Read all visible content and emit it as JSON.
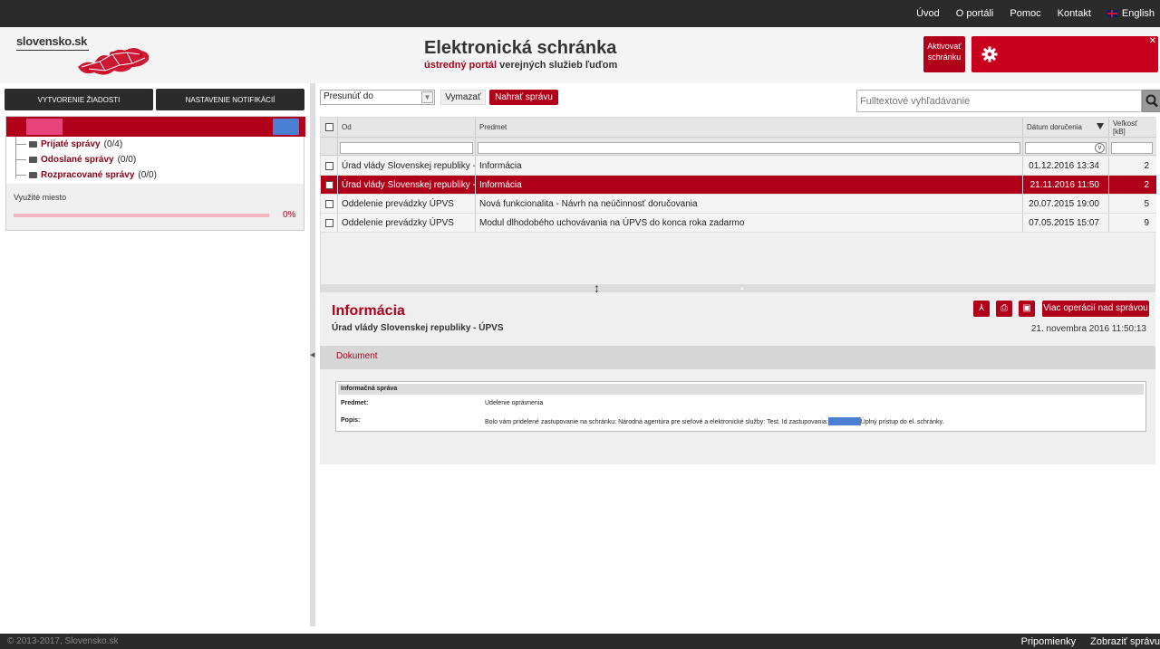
{
  "topnav": {
    "items": [
      "Úvod",
      "O portáli",
      "Pomoc",
      "Kontakt"
    ],
    "language": "English"
  },
  "header": {
    "logo_text": "slovensko.sk",
    "title": "Elektronická schránka",
    "subtitle_red": "ústredný portál",
    "subtitle_rest": "verejných služieb ľuďom",
    "activate_line1": "Aktivovať",
    "activate_line2": "schránku"
  },
  "sidebar": {
    "btn_create": "Vytvorenie žiadosti",
    "btn_notify": "Nastavenie notifikácií",
    "folders": [
      {
        "name": "Prijaté správy",
        "count": "(0/4)"
      },
      {
        "name": "Odoslané správy",
        "count": "(0/0)"
      },
      {
        "name": "Rozpracované správy",
        "count": "(0/0)"
      }
    ],
    "usage_label": "Využité miesto",
    "usage_pct": "0%",
    "usage_fraction": 0
  },
  "toolbar": {
    "move_select": "Presunúť do",
    "delete": "Vymazať",
    "upload": "Nahrať správu",
    "search_placeholder": "Fulltextové vyhľadávanie"
  },
  "grid": {
    "columns": {
      "from": "Od",
      "subject": "Predmet",
      "date": "Dátum doručenia",
      "size": "Veľkosť [kB]"
    },
    "rows": [
      {
        "from": "Úrad vlády Slovenskej republiky - ÚPVS",
        "subject": "Informácia",
        "date": "01.12.2016 13:34",
        "size": "2",
        "selected": false
      },
      {
        "from": "Úrad vlády Slovenskej republiky - ÚPVS",
        "subject": "Informácia",
        "date": "21.11.2016 11:50",
        "size": "2",
        "selected": true
      },
      {
        "from": "Oddelenie prevádzky ÚPVS",
        "subject": "Nová funkcionalita - Návrh na neúčinnosť doručovania",
        "date": "20.07.2015 19:00",
        "size": "5",
        "selected": false
      },
      {
        "from": "Oddelenie prevádzky ÚPVS",
        "subject": "Modul dlhodobého uchovávania na ÚPVS do konca roka zadarmo",
        "date": "07.05.2015 15:07",
        "size": "9",
        "selected": false
      }
    ]
  },
  "detail": {
    "title": "Informácia",
    "sender": "Úrad vlády Slovenskej republiky - ÚPVS",
    "date": "21. novembra 2016 11:50:13",
    "more_ops": "Viac operácií nad správou",
    "tab": "Dokument",
    "doc": {
      "heading": "Informačná správa",
      "subject_label": "Predmet:",
      "subject_value": "Udelenie oprávnenia",
      "desc_label": "Popis:",
      "desc_before": "Bolo vám pridelené zastupovanie na schránku: Národná agentúra pre sieťové a elektronické služby: Test. Id zastupovania:",
      "desc_after": "Úplný prístup do el. schránky."
    }
  },
  "footer": {
    "copyright": "© 2013-2017, Slovensko.sk",
    "links": [
      "Pripomienky",
      "Zobraziť správu"
    ]
  },
  "colors": {
    "brand_red": "#b0001a",
    "dark_bar": "#2b2b2b"
  }
}
